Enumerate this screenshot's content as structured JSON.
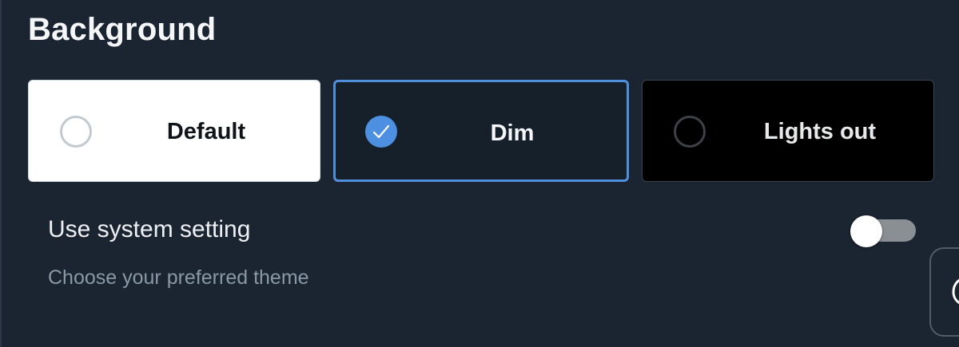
{
  "section": {
    "title": "Background"
  },
  "background_options": [
    {
      "label": "Default",
      "selected": false,
      "radio_icon": "radio-empty-icon"
    },
    {
      "label": "Dim",
      "selected": true,
      "radio_icon": "checkmark-icon"
    },
    {
      "label": "Lights out",
      "selected": false,
      "radio_icon": "radio-empty-icon"
    }
  ],
  "system_setting": {
    "label": "Use system setting",
    "enabled": false,
    "helper_text": "Choose your preferred theme"
  },
  "floating_button": {
    "icon": "chat-bubble-icon"
  },
  "colors": {
    "page_background": "#1b2431",
    "accent": "#4d8fe0",
    "default_option_bg": "#ffffff",
    "dim_option_bg": "#15202b",
    "lights_out_option_bg": "#000000",
    "muted_text": "#8b98a5"
  }
}
